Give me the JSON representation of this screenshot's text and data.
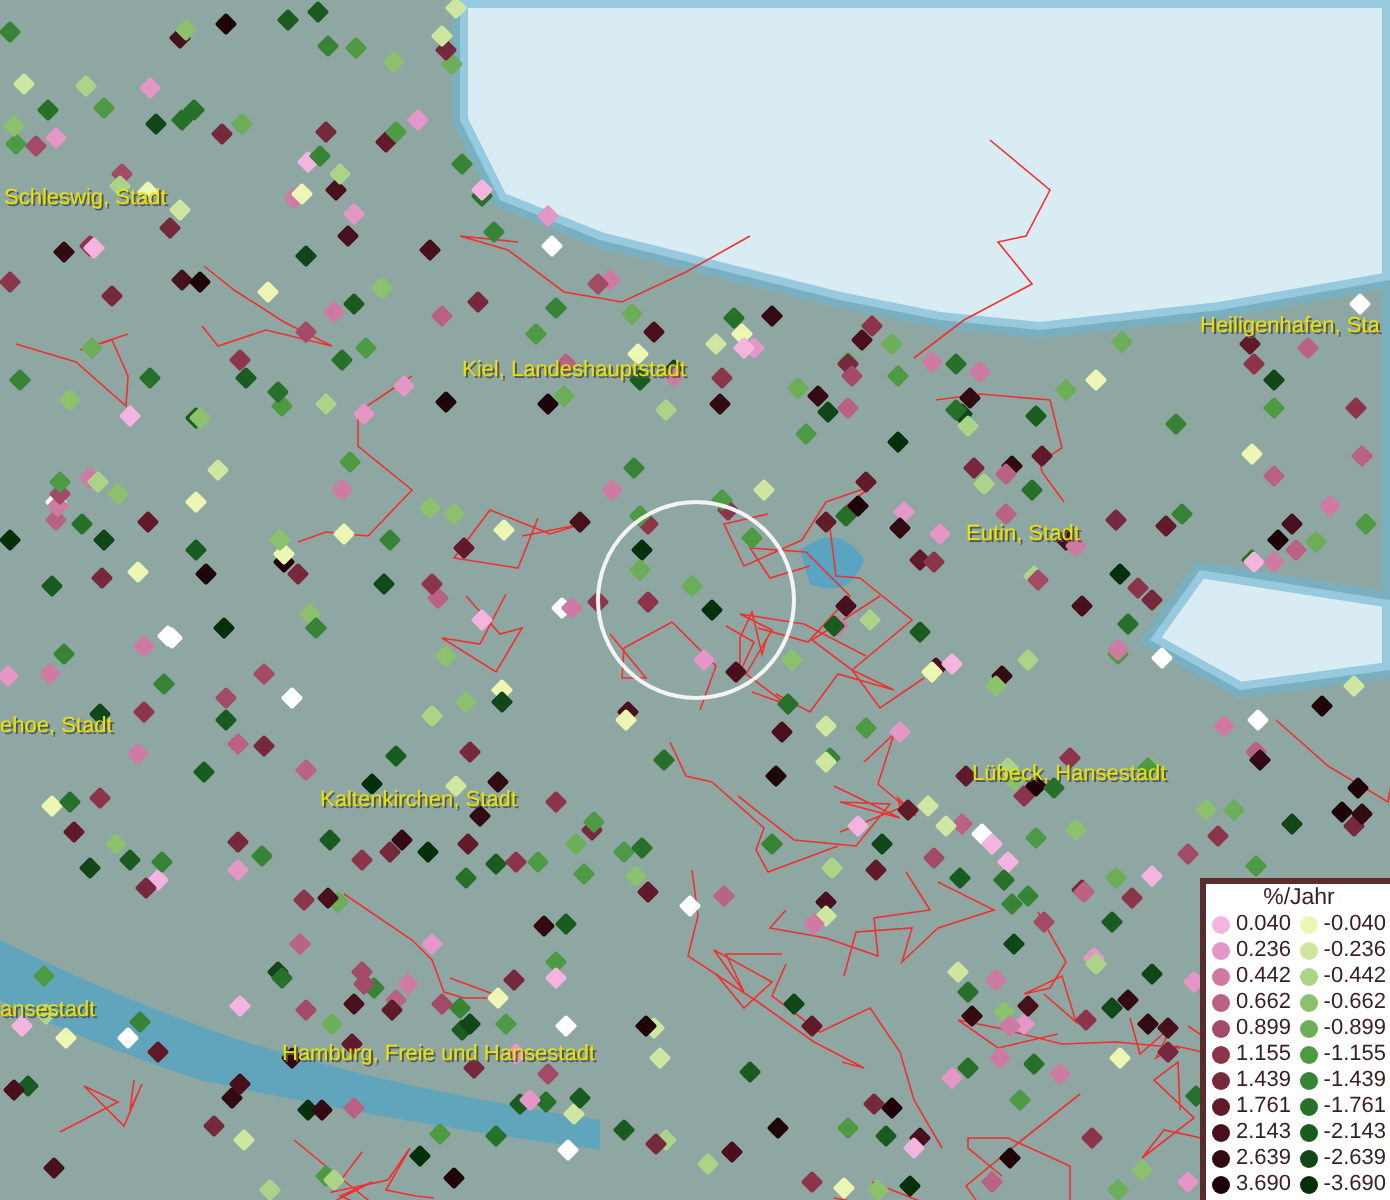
{
  "map": {
    "place_labels": [
      {
        "text": "Schleswig, Stadt"
      },
      {
        "text": "Kiel, Landeshauptstadt"
      },
      {
        "text": "Heiligenhafen, Sta"
      },
      {
        "text": "Eutin, Stadt"
      },
      {
        "text": "ehoe, Stadt"
      },
      {
        "text": "Kaltenkirchen, Stadt"
      },
      {
        "text": "Lübeck, Hansestadt"
      },
      {
        "text": "ansestadt"
      },
      {
        "text": "Hamburg, Freie und Hansestadt"
      }
    ]
  },
  "legend": {
    "title": "%/Jahr",
    "rows": [
      {
        "positive": {
          "value": "0.040",
          "color": "#f4b4e0"
        },
        "negative": {
          "value": "-0.040",
          "color": "#eef6b4"
        }
      },
      {
        "positive": {
          "value": "0.236",
          "color": "#e496c6"
        },
        "negative": {
          "value": "-0.236",
          "color": "#cfe6a0"
        }
      },
      {
        "positive": {
          "value": "0.442",
          "color": "#cf7aa2"
        },
        "negative": {
          "value": "-0.442",
          "color": "#acd488"
        }
      },
      {
        "positive": {
          "value": "0.662",
          "color": "#ba6284"
        },
        "negative": {
          "value": "-0.662",
          "color": "#8cc26e"
        }
      },
      {
        "positive": {
          "value": "0.899",
          "color": "#a24a66"
        },
        "negative": {
          "value": "-0.899",
          "color": "#6cae58"
        }
      },
      {
        "positive": {
          "value": "1.155",
          "color": "#8c344a"
        },
        "negative": {
          "value": "-1.155",
          "color": "#4e9a44"
        }
      },
      {
        "positive": {
          "value": "1.439",
          "color": "#76283c"
        },
        "negative": {
          "value": "-1.439",
          "color": "#388436"
        }
      },
      {
        "positive": {
          "value": "1.761",
          "color": "#601a2a"
        },
        "negative": {
          "value": "-1.761",
          "color": "#26702a"
        }
      },
      {
        "positive": {
          "value": "2.143",
          "color": "#48101c"
        },
        "negative": {
          "value": "-2.143",
          "color": "#1a5c20"
        }
      },
      {
        "positive": {
          "value": "2.639",
          "color": "#320a12"
        },
        "negative": {
          "value": "-2.639",
          "color": "#104618"
        }
      },
      {
        "positive": {
          "value": "3.690",
          "color": "#1e0408"
        },
        "negative": {
          "value": "-3.690",
          "color": "#06300c"
        }
      }
    ]
  }
}
